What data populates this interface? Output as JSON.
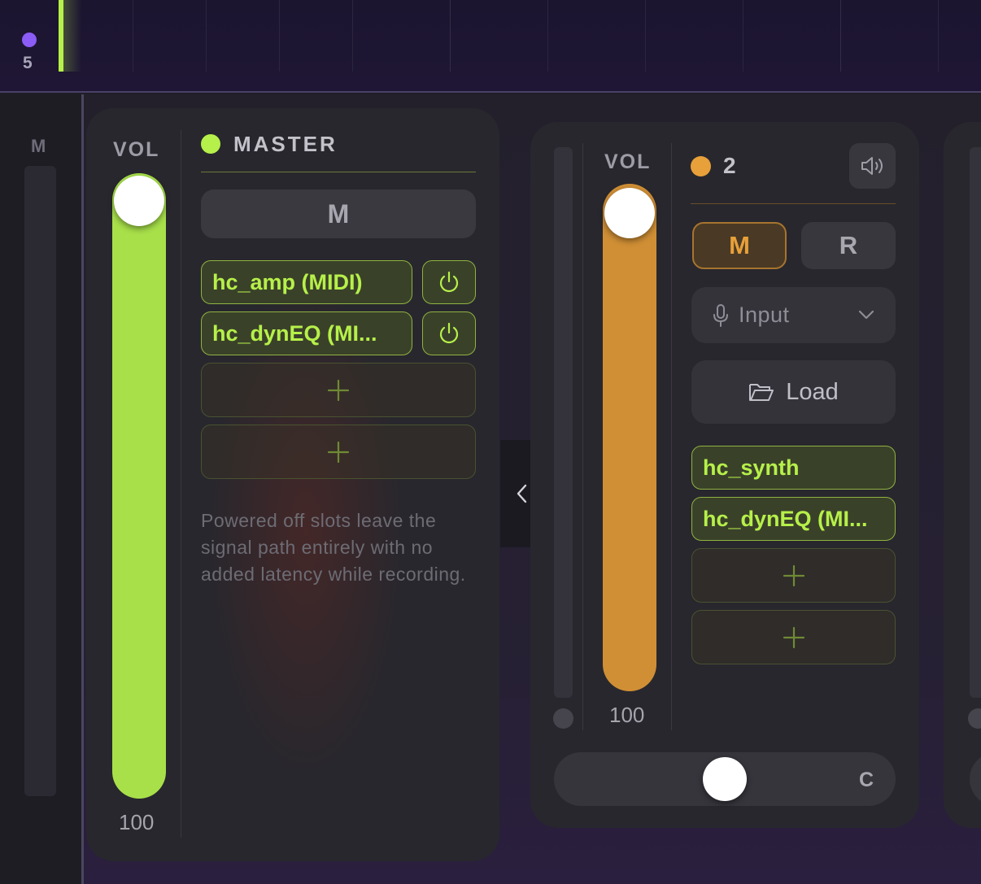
{
  "timeline": {
    "marker_number": "5",
    "marker_color": "#8b5cf6",
    "playhead_color": "#b6f04a"
  },
  "left_rail": {
    "label": "M"
  },
  "master": {
    "title": "MASTER",
    "color": "#b6f04a",
    "vol_label": "VOL",
    "vol_value": "100",
    "vol_level": 1.0,
    "mute_label": "M",
    "slots": [
      {
        "label": "hc_amp (MIDI)",
        "power": true
      },
      {
        "label": "hc_dynEQ (MI...",
        "power": true
      }
    ],
    "empty_slots": [
      "+",
      "+"
    ],
    "hint": "Powered off slots leave the signal path entirely with no added latency while recording."
  },
  "collapse": {
    "icon": "chevron-left-icon"
  },
  "track2": {
    "number": "2",
    "color": "#e8a03a",
    "vol_label": "VOL",
    "vol_value": "100",
    "vol_level": 1.0,
    "mute_label": "M",
    "record_label": "R",
    "mute_active": true,
    "input_label": "Input",
    "load_label": "Load",
    "slots": [
      {
        "label": "hc_synth"
      },
      {
        "label": "hc_dynEQ (MI..."
      }
    ],
    "empty_slots": [
      "+",
      "+"
    ],
    "pan_label": "C",
    "pan_value": 0.5
  }
}
